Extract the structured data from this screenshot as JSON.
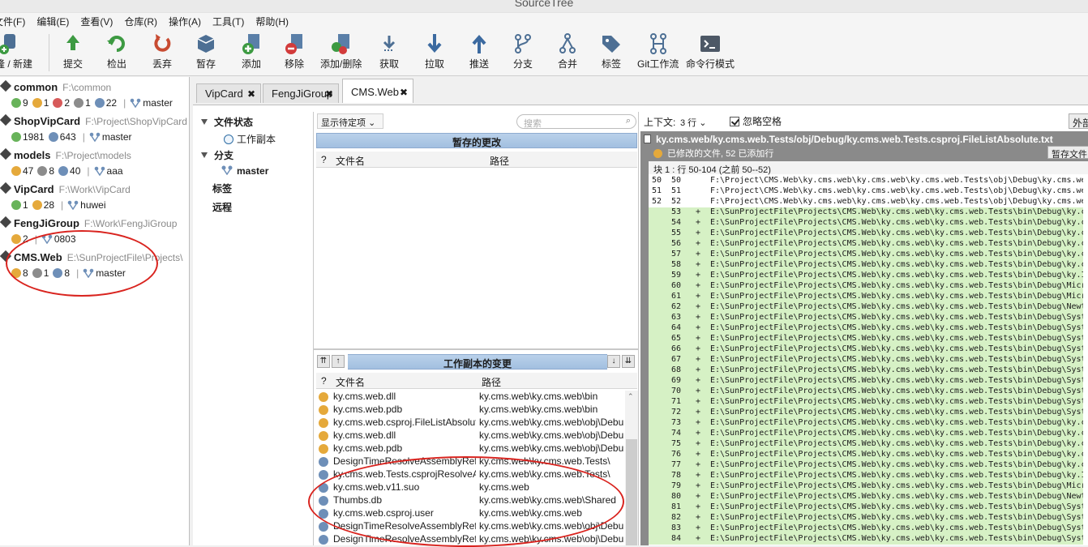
{
  "window": {
    "title": "SourceTree"
  },
  "menu": [
    "文件(F)",
    "编辑(E)",
    "查看(V)",
    "仓库(R)",
    "操作(A)",
    "工具(T)",
    "帮助(H)"
  ],
  "toolbar": [
    {
      "label": "克隆 / 新建",
      "icon": "database-add-icon"
    },
    {
      "label": "提交",
      "icon": "commit-icon"
    },
    {
      "label": "检出",
      "icon": "checkout-icon"
    },
    {
      "label": "丢弃",
      "icon": "discard-icon"
    },
    {
      "label": "暂存",
      "icon": "stash-icon"
    },
    {
      "label": "添加",
      "icon": "add-icon"
    },
    {
      "label": "移除",
      "icon": "remove-icon"
    },
    {
      "label": "添加/删除",
      "icon": "add-remove-icon"
    },
    {
      "label": "获取",
      "icon": "fetch-icon"
    },
    {
      "label": "拉取",
      "icon": "pull-icon"
    },
    {
      "label": "推送",
      "icon": "push-icon"
    },
    {
      "label": "分支",
      "icon": "branch-icon"
    },
    {
      "label": "合并",
      "icon": "merge-icon"
    },
    {
      "label": "标签",
      "icon": "tag-icon"
    },
    {
      "label": "Git工作流",
      "icon": "git-flow-icon"
    },
    {
      "label": "命令行模式",
      "icon": "terminal-icon"
    }
  ],
  "repos": [
    {
      "name": "common",
      "path": "F:\\common",
      "stats": [
        {
          "t": "add",
          "v": "9"
        },
        {
          "t": "mod",
          "v": "1"
        },
        {
          "t": "del",
          "v": "2"
        },
        {
          "t": "ign",
          "v": "1"
        },
        {
          "t": "unk",
          "v": "22"
        }
      ],
      "branch": "master"
    },
    {
      "name": "ShopVipCard",
      "path": "F:\\Project\\ShopVipCard",
      "stats": [
        {
          "t": "add",
          "v": "1981"
        },
        {
          "t": "unk",
          "v": "643"
        }
      ],
      "branch": "master"
    },
    {
      "name": "models",
      "path": "F:\\Project\\models",
      "stats": [
        {
          "t": "mod",
          "v": "47"
        },
        {
          "t": "ign",
          "v": "8"
        },
        {
          "t": "unk",
          "v": "40"
        }
      ],
      "branch": "aaa"
    },
    {
      "name": "VipCard",
      "path": "F:\\Work\\VipCard",
      "stats": [
        {
          "t": "add",
          "v": "1"
        },
        {
          "t": "mod",
          "v": "28"
        }
      ],
      "branch": "huwei"
    },
    {
      "name": "FengJiGroup",
      "path": "F:\\Work\\FengJiGroup",
      "stats": [
        {
          "t": "mod",
          "v": "2"
        }
      ],
      "branch": "0803"
    },
    {
      "name": "CMS.Web",
      "path": "E:\\SunProjectFile\\Projects\\",
      "stats": [
        {
          "t": "mod",
          "v": "8"
        },
        {
          "t": "ign",
          "v": "1"
        },
        {
          "t": "unk",
          "v": "8"
        }
      ],
      "branch": "master"
    }
  ],
  "tabs": [
    "VipCard",
    "FengJiGroup",
    "CMS.Web"
  ],
  "close_glyph": "✖",
  "nav": {
    "file_status": "文件状态",
    "working_copy": "工作副本",
    "branches": "分支",
    "branch_master": "master",
    "tags": "标签",
    "remotes": "远程"
  },
  "staged": {
    "filter_label": "显示待定项",
    "search_placeholder": "搜索",
    "header": "暂存的更改",
    "col_q": "?",
    "col_name": "文件名",
    "col_path": "路径"
  },
  "working": {
    "header": "工作副本的变更",
    "col_q": "?",
    "col_name": "文件名",
    "col_path": "路径",
    "files": [
      {
        "s": "mod",
        "name": "ky.cms.web.dll",
        "path": "ky.cms.web\\ky.cms.web\\bin"
      },
      {
        "s": "mod",
        "name": "ky.cms.web.pdb",
        "path": "ky.cms.web\\ky.cms.web\\bin"
      },
      {
        "s": "mod",
        "name": "ky.cms.web.csproj.FileListAbsolute.txt",
        "path": "ky.cms.web\\ky.cms.web\\obj\\Debug"
      },
      {
        "s": "mod",
        "name": "ky.cms.web.dll",
        "path": "ky.cms.web\\ky.cms.web\\obj\\Debug"
      },
      {
        "s": "mod",
        "name": "ky.cms.web.pdb",
        "path": "ky.cms.web\\ky.cms.web\\obj\\Debug"
      },
      {
        "s": "unk",
        "name": "DesignTimeResolveAssemblyReferences",
        "path": "ky.cms.web\\ky.cms.web.Tests\\"
      },
      {
        "s": "unk",
        "name": "ky.cms.web.Tests.csprojResolveAssembly",
        "path": "ky.cms.web\\ky.cms.web.Tests\\"
      },
      {
        "s": "unk",
        "name": "ky.cms.web.v11.suo",
        "path": "ky.cms.web"
      },
      {
        "s": "unk",
        "name": "Thumbs.db",
        "path": "ky.cms.web\\ky.cms.web\\Shared"
      },
      {
        "s": "unk",
        "name": "ky.cms.web.csproj.user",
        "path": "ky.cms.web\\ky.cms.web"
      },
      {
        "s": "unk",
        "name": "DesignTimeResolveAssemblyReferences",
        "path": "ky.cms.web\\ky.cms.web\\obj\\Debug"
      },
      {
        "s": "unk",
        "name": "DesignTimeResolveAssemblyReferences",
        "path": "ky.cms.web\\ky.cms.web\\obj\\Debug"
      }
    ]
  },
  "diff": {
    "context_label": "上下文:",
    "context_value": "3 行",
    "ignore_ws": "忽略空格",
    "external_btn": "外部",
    "file": "ky.cms.web/ky.cms.web.Tests/obj/Debug/ky.cms.web.Tests.csproj.FileListAbsolute.txt",
    "summary": "已修改的文件, 52 已添加行",
    "stage_file_btn": "暂存文件",
    "hunk": "块 1 : 行 50-104 (之前 50--52)",
    "context_lines": [
      {
        "o": "50",
        "n": "50",
        "t": "F:\\Project\\CMS.Web\\ky.cms.web\\ky.cms.web\\ky.cms.web.Tests\\obj\\Debug\\ky.cms.web.Tests.csproj"
      },
      {
        "o": "51",
        "n": "51",
        "t": "F:\\Project\\CMS.Web\\ky.cms.web\\ky.cms.web\\ky.cms.web.Tests\\obj\\Debug\\ky.cms.web.Tests.dll"
      },
      {
        "o": "52",
        "n": "52",
        "t": "F:\\Project\\CMS.Web\\ky.cms.web\\ky.cms.web\\ky.cms.web.Tests\\obj\\Debug\\ky.cms.web.Tests.pdb"
      }
    ],
    "added_lines": [
      {
        "n": "53",
        "t": "E:\\SunProjectFile\\Projects\\CMS.Web\\ky.cms.web\\ky.cms.web.Tests\\bin\\Debug\\ky.c"
      },
      {
        "n": "54",
        "t": "E:\\SunProjectFile\\Projects\\CMS.Web\\ky.cms.web\\ky.cms.web.Tests\\bin\\Debug\\ky.c"
      },
      {
        "n": "55",
        "t": "E:\\SunProjectFile\\Projects\\CMS.Web\\ky.cms.web\\ky.cms.web.Tests\\bin\\Debug\\ky.c"
      },
      {
        "n": "56",
        "t": "E:\\SunProjectFile\\Projects\\CMS.Web\\ky.cms.web\\ky.cms.web.Tests\\bin\\Debug\\ky.c"
      },
      {
        "n": "57",
        "t": "E:\\SunProjectFile\\Projects\\CMS.Web\\ky.cms.web\\ky.cms.web.Tests\\bin\\Debug\\ky.c"
      },
      {
        "n": "58",
        "t": "E:\\SunProjectFile\\Projects\\CMS.Web\\ky.cms.web\\ky.cms.web.Tests\\bin\\Debug\\ky.c"
      },
      {
        "n": "59",
        "t": "E:\\SunProjectFile\\Projects\\CMS.Web\\ky.cms.web\\ky.cms.web.Tests\\bin\\Debug\\ky.I"
      },
      {
        "n": "60",
        "t": "E:\\SunProjectFile\\Projects\\CMS.Web\\ky.cms.web\\ky.cms.web.Tests\\bin\\Debug\\Micr"
      },
      {
        "n": "61",
        "t": "E:\\SunProjectFile\\Projects\\CMS.Web\\ky.cms.web\\ky.cms.web.Tests\\bin\\Debug\\Micr"
      },
      {
        "n": "62",
        "t": "E:\\SunProjectFile\\Projects\\CMS.Web\\ky.cms.web\\ky.cms.web.Tests\\bin\\Debug\\Newt"
      },
      {
        "n": "63",
        "t": "E:\\SunProjectFile\\Projects\\CMS.Web\\ky.cms.web\\ky.cms.web.Tests\\bin\\Debug\\Syst"
      },
      {
        "n": "64",
        "t": "E:\\SunProjectFile\\Projects\\CMS.Web\\ky.cms.web\\ky.cms.web.Tests\\bin\\Debug\\Syst"
      },
      {
        "n": "65",
        "t": "E:\\SunProjectFile\\Projects\\CMS.Web\\ky.cms.web\\ky.cms.web.Tests\\bin\\Debug\\Syst"
      },
      {
        "n": "66",
        "t": "E:\\SunProjectFile\\Projects\\CMS.Web\\ky.cms.web\\ky.cms.web.Tests\\bin\\Debug\\Syst"
      },
      {
        "n": "67",
        "t": "E:\\SunProjectFile\\Projects\\CMS.Web\\ky.cms.web\\ky.cms.web.Tests\\bin\\Debug\\Syst"
      },
      {
        "n": "68",
        "t": "E:\\SunProjectFile\\Projects\\CMS.Web\\ky.cms.web\\ky.cms.web.Tests\\bin\\Debug\\Syst"
      },
      {
        "n": "69",
        "t": "E:\\SunProjectFile\\Projects\\CMS.Web\\ky.cms.web\\ky.cms.web.Tests\\bin\\Debug\\Syst"
      },
      {
        "n": "70",
        "t": "E:\\SunProjectFile\\Projects\\CMS.Web\\ky.cms.web\\ky.cms.web.Tests\\bin\\Debug\\Syst"
      },
      {
        "n": "71",
        "t": "E:\\SunProjectFile\\Projects\\CMS.Web\\ky.cms.web\\ky.cms.web.Tests\\bin\\Debug\\Syst"
      },
      {
        "n": "72",
        "t": "E:\\SunProjectFile\\Projects\\CMS.Web\\ky.cms.web\\ky.cms.web.Tests\\bin\\Debug\\Syst"
      },
      {
        "n": "73",
        "t": "E:\\SunProjectFile\\Projects\\CMS.Web\\ky.cms.web\\ky.cms.web.Tests\\bin\\Debug\\ky.c"
      },
      {
        "n": "74",
        "t": "E:\\SunProjectFile\\Projects\\CMS.Web\\ky.cms.web\\ky.cms.web.Tests\\bin\\Debug\\ky.c"
      },
      {
        "n": "75",
        "t": "E:\\SunProjectFile\\Projects\\CMS.Web\\ky.cms.web\\ky.cms.web.Tests\\bin\\Debug\\ky.c"
      },
      {
        "n": "76",
        "t": "E:\\SunProjectFile\\Projects\\CMS.Web\\ky.cms.web\\ky.cms.web.Tests\\bin\\Debug\\ky.c"
      },
      {
        "n": "77",
        "t": "E:\\SunProjectFile\\Projects\\CMS.Web\\ky.cms.web\\ky.cms.web.Tests\\bin\\Debug\\ky.c"
      },
      {
        "n": "78",
        "t": "E:\\SunProjectFile\\Projects\\CMS.Web\\ky.cms.web\\ky.cms.web.Tests\\bin\\Debug\\ky.I"
      },
      {
        "n": "79",
        "t": "E:\\SunProjectFile\\Projects\\CMS.Web\\ky.cms.web\\ky.cms.web.Tests\\bin\\Debug\\Micr"
      },
      {
        "n": "80",
        "t": "E:\\SunProjectFile\\Projects\\CMS.Web\\ky.cms.web\\ky.cms.web.Tests\\bin\\Debug\\Newt"
      },
      {
        "n": "81",
        "t": "E:\\SunProjectFile\\Projects\\CMS.Web\\ky.cms.web\\ky.cms.web.Tests\\bin\\Debug\\Syst"
      },
      {
        "n": "82",
        "t": "E:\\SunProjectFile\\Projects\\CMS.Web\\ky.cms.web\\ky.cms.web.Tests\\bin\\Debug\\Syst"
      },
      {
        "n": "83",
        "t": "E:\\SunProjectFile\\Projects\\CMS.Web\\ky.cms.web\\ky.cms.web.Tests\\bin\\Debug\\Syst"
      },
      {
        "n": "84",
        "t": "E:\\SunProjectFile\\Projects\\CMS.Web\\ky.cms.web\\ky.cms.web.Tests\\bin\\Debug\\Syst"
      }
    ]
  },
  "colors": {
    "accent_blue": "#a2bfe0",
    "added_bg": "#d6f1c5",
    "annotation_red": "#d9241f"
  }
}
